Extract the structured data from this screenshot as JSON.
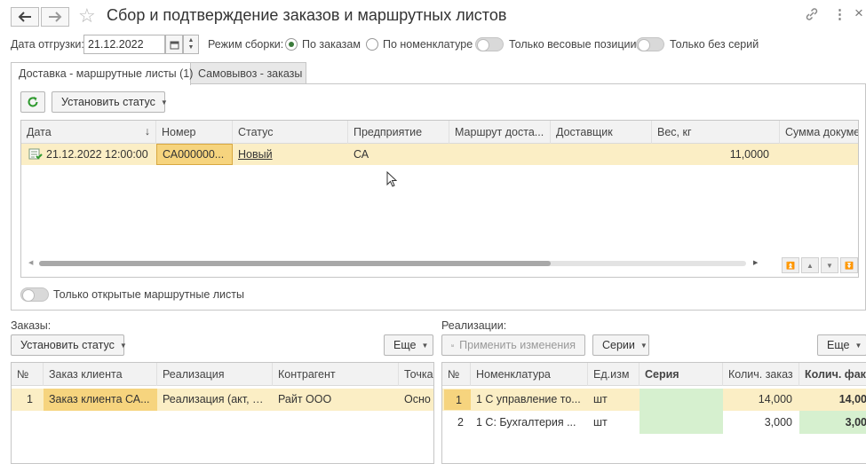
{
  "window": {
    "title": "Сбор и подтверждение заказов и маршрутных листов",
    "back_icon": "arrow-left-icon",
    "forward_icon": "arrow-right-icon",
    "star_icon": "star-icon",
    "link_icon": "link-icon",
    "more_icon": "more-vert-icon",
    "close_label": "×"
  },
  "toolbar": {
    "date_label": "Дата отгрузки:",
    "date_value": "21.12.2022",
    "mode_label": "Режим сборки:",
    "radio_by_orders": "По заказам",
    "radio_by_nomenclature": "По номенклатуре",
    "toggle_weight": "Только весовые позиции",
    "toggle_no_series": "Только без серий"
  },
  "tabs": [
    {
      "label": "Доставка - маршрутные листы (1)",
      "active": true
    },
    {
      "label": "Самовывоз - заказы",
      "active": false
    }
  ],
  "routes": {
    "set_status_label": "Установить статус",
    "columns": [
      "Дата",
      "Номер",
      "Статус",
      "Предприятие",
      "Маршрут доста...",
      "Доставщик",
      "Вес, кг",
      "Сумма докуме"
    ],
    "rows": [
      {
        "date": "21.12.2022 12:00:00",
        "number": "СА000000...",
        "status": "Новый",
        "company": "СА",
        "route": "",
        "courier": "",
        "weight": "11,0000",
        "sum": ""
      }
    ],
    "open_only_label": "Только открытые маршрутные листы"
  },
  "orders": {
    "section_label": "Заказы:",
    "set_status_label": "Установить статус",
    "more_label": "Еще",
    "columns": [
      "№",
      "Заказ клиента",
      "Реализация",
      "Контрагент",
      "Точка"
    ],
    "rows": [
      {
        "n": "1",
        "order": "Заказ клиента СА...",
        "realization": "Реализация (акт, н...",
        "contractor": "Райт ООО",
        "point": "Осно"
      }
    ]
  },
  "realizations": {
    "section_label": "Реализации:",
    "apply_label": "Применить изменения",
    "series_label": "Серии",
    "more_label": "Еще",
    "columns": [
      "№",
      "Номенклатура",
      "Ед.изм",
      "Серия",
      "Колич. заказ",
      "Колич. фак"
    ],
    "rows": [
      {
        "n": "1",
        "name": "1 С управление то...",
        "unit": "шт",
        "series": "",
        "qty_order": "14,000",
        "qty_fact": "14,00"
      },
      {
        "n": "2",
        "name": "1 С:  Бухгалтерия ...",
        "unit": "шт",
        "series": "",
        "qty_order": "3,000",
        "qty_fact": "3,00"
      }
    ]
  },
  "colors": {
    "selected_row": "#fbeec5",
    "selected_cell": "#f6d47e",
    "series_green": "#d6f0cf",
    "accent_green": "#3a7a3a"
  }
}
